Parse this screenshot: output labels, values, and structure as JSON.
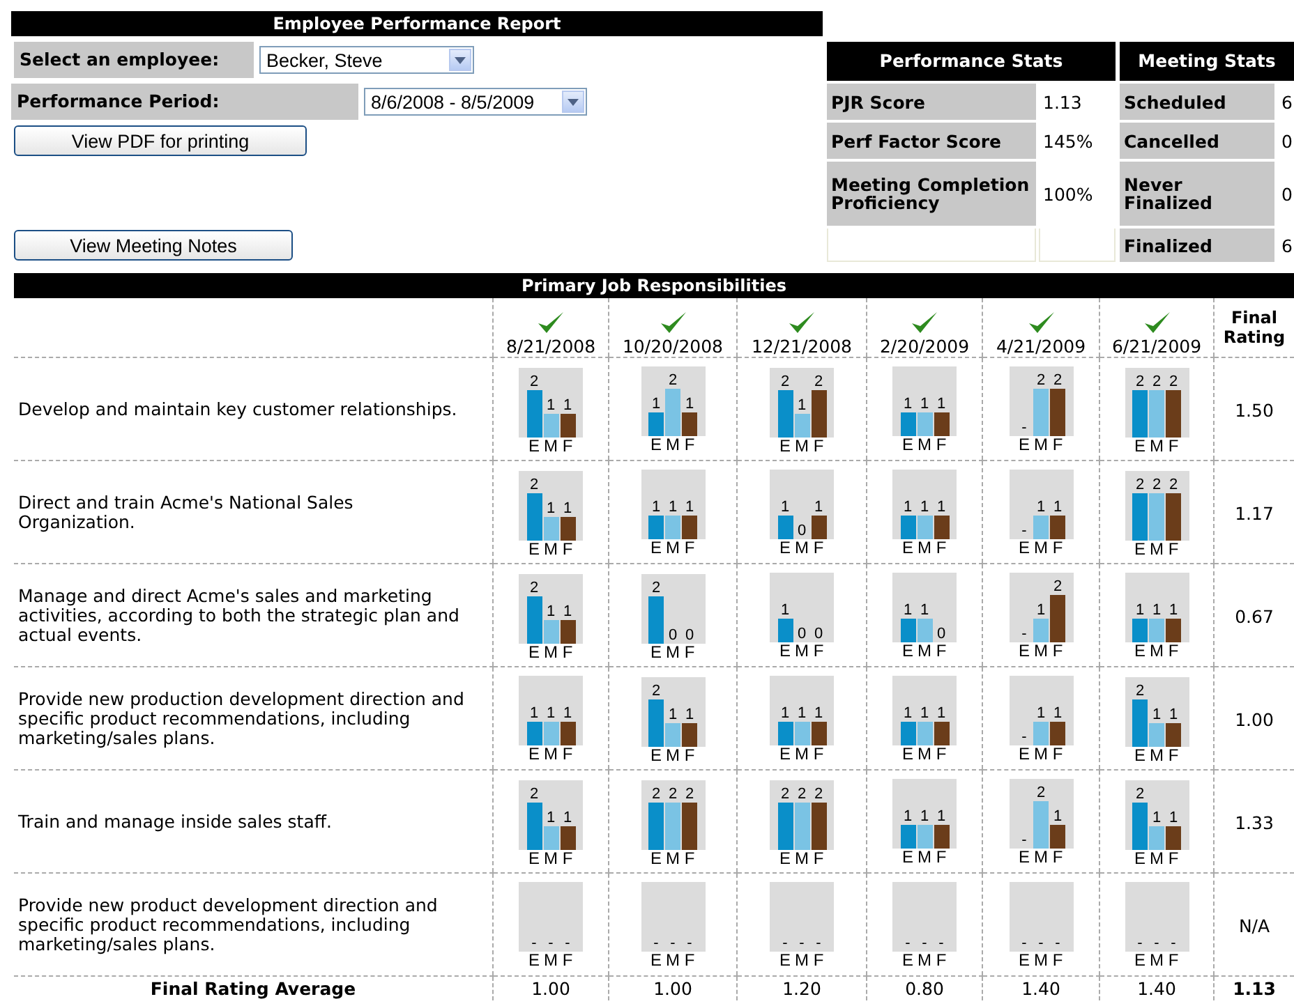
{
  "title": "Employee Performance Report",
  "employee": {
    "label": "Select an employee:",
    "value": "Becker, Steve"
  },
  "period": {
    "label": "Performance Period:",
    "value": "8/6/2008 - 8/5/2009"
  },
  "buttons": [
    "View PDF for printing",
    "View Meeting Notes"
  ],
  "performance_stats": {
    "title": "Performance Stats",
    "rows": [
      {
        "label": "PJR Score",
        "value": "1.13"
      },
      {
        "label": "Perf Factor Score",
        "value": "145%"
      },
      {
        "label": "Meeting Completion Proficiency",
        "value": "100%"
      }
    ]
  },
  "meeting_stats": {
    "title": "Meeting Stats",
    "rows": [
      {
        "label": "Scheduled",
        "value": "6"
      },
      {
        "label": "Cancelled",
        "value": "0"
      },
      {
        "label": "Never Finalized",
        "value": "0"
      },
      {
        "label": "Finalized",
        "value": "6"
      }
    ]
  },
  "responsibilities": {
    "title": "Primary Job Responsibilities",
    "final_header": "Final Rating",
    "columns": [
      {
        "date": "8/21/2008",
        "completed": true
      },
      {
        "date": "10/20/2008",
        "completed": true
      },
      {
        "date": "12/21/2008",
        "completed": true
      },
      {
        "date": "2/20/2009",
        "completed": true
      },
      {
        "date": "4/21/2009",
        "completed": true
      },
      {
        "date": "6/21/2009",
        "completed": true
      }
    ],
    "rows": [
      {
        "text": "Develop and maintain key customer relationships.",
        "final": "1.50",
        "cells": [
          {
            "values": [
              "2",
              "1",
              "1"
            ],
            "labels": [
              "E",
              "M",
              "F"
            ]
          },
          {
            "values": [
              "1",
              "2",
              "1"
            ],
            "labels": [
              "E",
              "M",
              "F"
            ]
          },
          {
            "values": [
              "2",
              "1",
              "2"
            ],
            "labels": [
              "E",
              "M",
              "F"
            ]
          },
          {
            "values": [
              "1",
              "1",
              "1"
            ],
            "labels": [
              "E",
              "M",
              "F"
            ]
          },
          {
            "values": [
              "-",
              "2",
              "2"
            ],
            "labels": [
              "E",
              "M",
              "F"
            ]
          },
          {
            "values": [
              "2",
              "2",
              "2"
            ],
            "labels": [
              "E",
              "M",
              "F"
            ]
          }
        ]
      },
      {
        "text": "Direct and train Acme's National Sales Organization.",
        "final": "1.17",
        "cells": [
          {
            "values": [
              "2",
              "1",
              "1"
            ],
            "labels": [
              "E",
              "M",
              "F"
            ]
          },
          {
            "values": [
              "1",
              "1",
              "1"
            ],
            "labels": [
              "E",
              "M",
              "F"
            ]
          },
          {
            "values": [
              "1",
              "0",
              "1"
            ],
            "labels": [
              "E",
              "M",
              "F"
            ]
          },
          {
            "values": [
              "1",
              "1",
              "1"
            ],
            "labels": [
              "E",
              "M",
              "F"
            ]
          },
          {
            "values": [
              "-",
              "1",
              "1"
            ],
            "labels": [
              "E",
              "M",
              "F"
            ]
          },
          {
            "values": [
              "2",
              "2",
              "2"
            ],
            "labels": [
              "E",
              "M",
              "F"
            ]
          }
        ]
      },
      {
        "text": "Manage and direct Acme's sales and marketing activities, according to both the strategic plan and actual events.",
        "final": "0.67",
        "cells": [
          {
            "values": [
              "2",
              "1",
              "1"
            ],
            "labels": [
              "E",
              "M",
              "F"
            ]
          },
          {
            "values": [
              "2",
              "0",
              "0"
            ],
            "labels": [
              "E",
              "M",
              "F"
            ]
          },
          {
            "values": [
              "1",
              "0",
              "0"
            ],
            "labels": [
              "E",
              "M",
              "F"
            ]
          },
          {
            "values": [
              "1",
              "1",
              "0"
            ],
            "labels": [
              "E",
              "M",
              "F"
            ]
          },
          {
            "values": [
              "-",
              "1",
              "2"
            ],
            "labels": [
              "E",
              "M",
              "F"
            ]
          },
          {
            "values": [
              "1",
              "1",
              "1"
            ],
            "labels": [
              "E",
              "M",
              "F"
            ]
          }
        ]
      },
      {
        "text": "Provide new production development direction and specific product recommendations, including marketing/sales plans.",
        "final": "1.00",
        "cells": [
          {
            "values": [
              "1",
              "1",
              "1"
            ],
            "labels": [
              "E",
              "M",
              "F"
            ]
          },
          {
            "values": [
              "2",
              "1",
              "1"
            ],
            "labels": [
              "E",
              "M",
              "F"
            ]
          },
          {
            "values": [
              "1",
              "1",
              "1"
            ],
            "labels": [
              "E",
              "M",
              "F"
            ]
          },
          {
            "values": [
              "1",
              "1",
              "1"
            ],
            "labels": [
              "E",
              "M",
              "F"
            ]
          },
          {
            "values": [
              "-",
              "1",
              "1"
            ],
            "labels": [
              "E",
              "M",
              "F"
            ]
          },
          {
            "values": [
              "2",
              "1",
              "1"
            ],
            "labels": [
              "E",
              "M",
              "F"
            ]
          }
        ]
      },
      {
        "text": "Train and manage inside sales staff.",
        "final": "1.33",
        "cells": [
          {
            "values": [
              "2",
              "1",
              "1"
            ],
            "labels": [
              "E",
              "M",
              "F"
            ]
          },
          {
            "values": [
              "2",
              "2",
              "2"
            ],
            "labels": [
              "E",
              "M",
              "F"
            ]
          },
          {
            "values": [
              "2",
              "2",
              "2"
            ],
            "labels": [
              "E",
              "M",
              "F"
            ]
          },
          {
            "values": [
              "1",
              "1",
              "1"
            ],
            "labels": [
              "E",
              "M",
              "F"
            ]
          },
          {
            "values": [
              "-",
              "2",
              "1"
            ],
            "labels": [
              "E",
              "M",
              "F"
            ]
          },
          {
            "values": [
              "2",
              "1",
              "1"
            ],
            "labels": [
              "E",
              "M",
              "F"
            ]
          }
        ]
      },
      {
        "text": "Provide new product development direction and specific product recommendations, including marketing/sales plans.",
        "final": "N/A",
        "cells": [
          {
            "values": [
              "-",
              "-",
              "-"
            ],
            "labels": [
              "E",
              "M",
              "F"
            ]
          },
          {
            "values": [
              "-",
              "-",
              "-"
            ],
            "labels": [
              "E",
              "M",
              "F"
            ]
          },
          {
            "values": [
              "-",
              "-",
              "-"
            ],
            "labels": [
              "E",
              "M",
              "F"
            ]
          },
          {
            "values": [
              "-",
              "-",
              "-"
            ],
            "labels": [
              "E",
              "M",
              "F"
            ]
          },
          {
            "values": [
              "-",
              "-",
              "-"
            ],
            "labels": [
              "E",
              "M",
              "F"
            ]
          },
          {
            "values": [
              "-",
              "-",
              "-"
            ],
            "labels": [
              "E",
              "M",
              "F"
            ]
          }
        ]
      }
    ],
    "footer": {
      "label": "Final Rating Average",
      "values": [
        "1.00",
        "1.00",
        "1.20",
        "0.80",
        "1.40",
        "1.40"
      ],
      "final": "1.13"
    }
  }
}
